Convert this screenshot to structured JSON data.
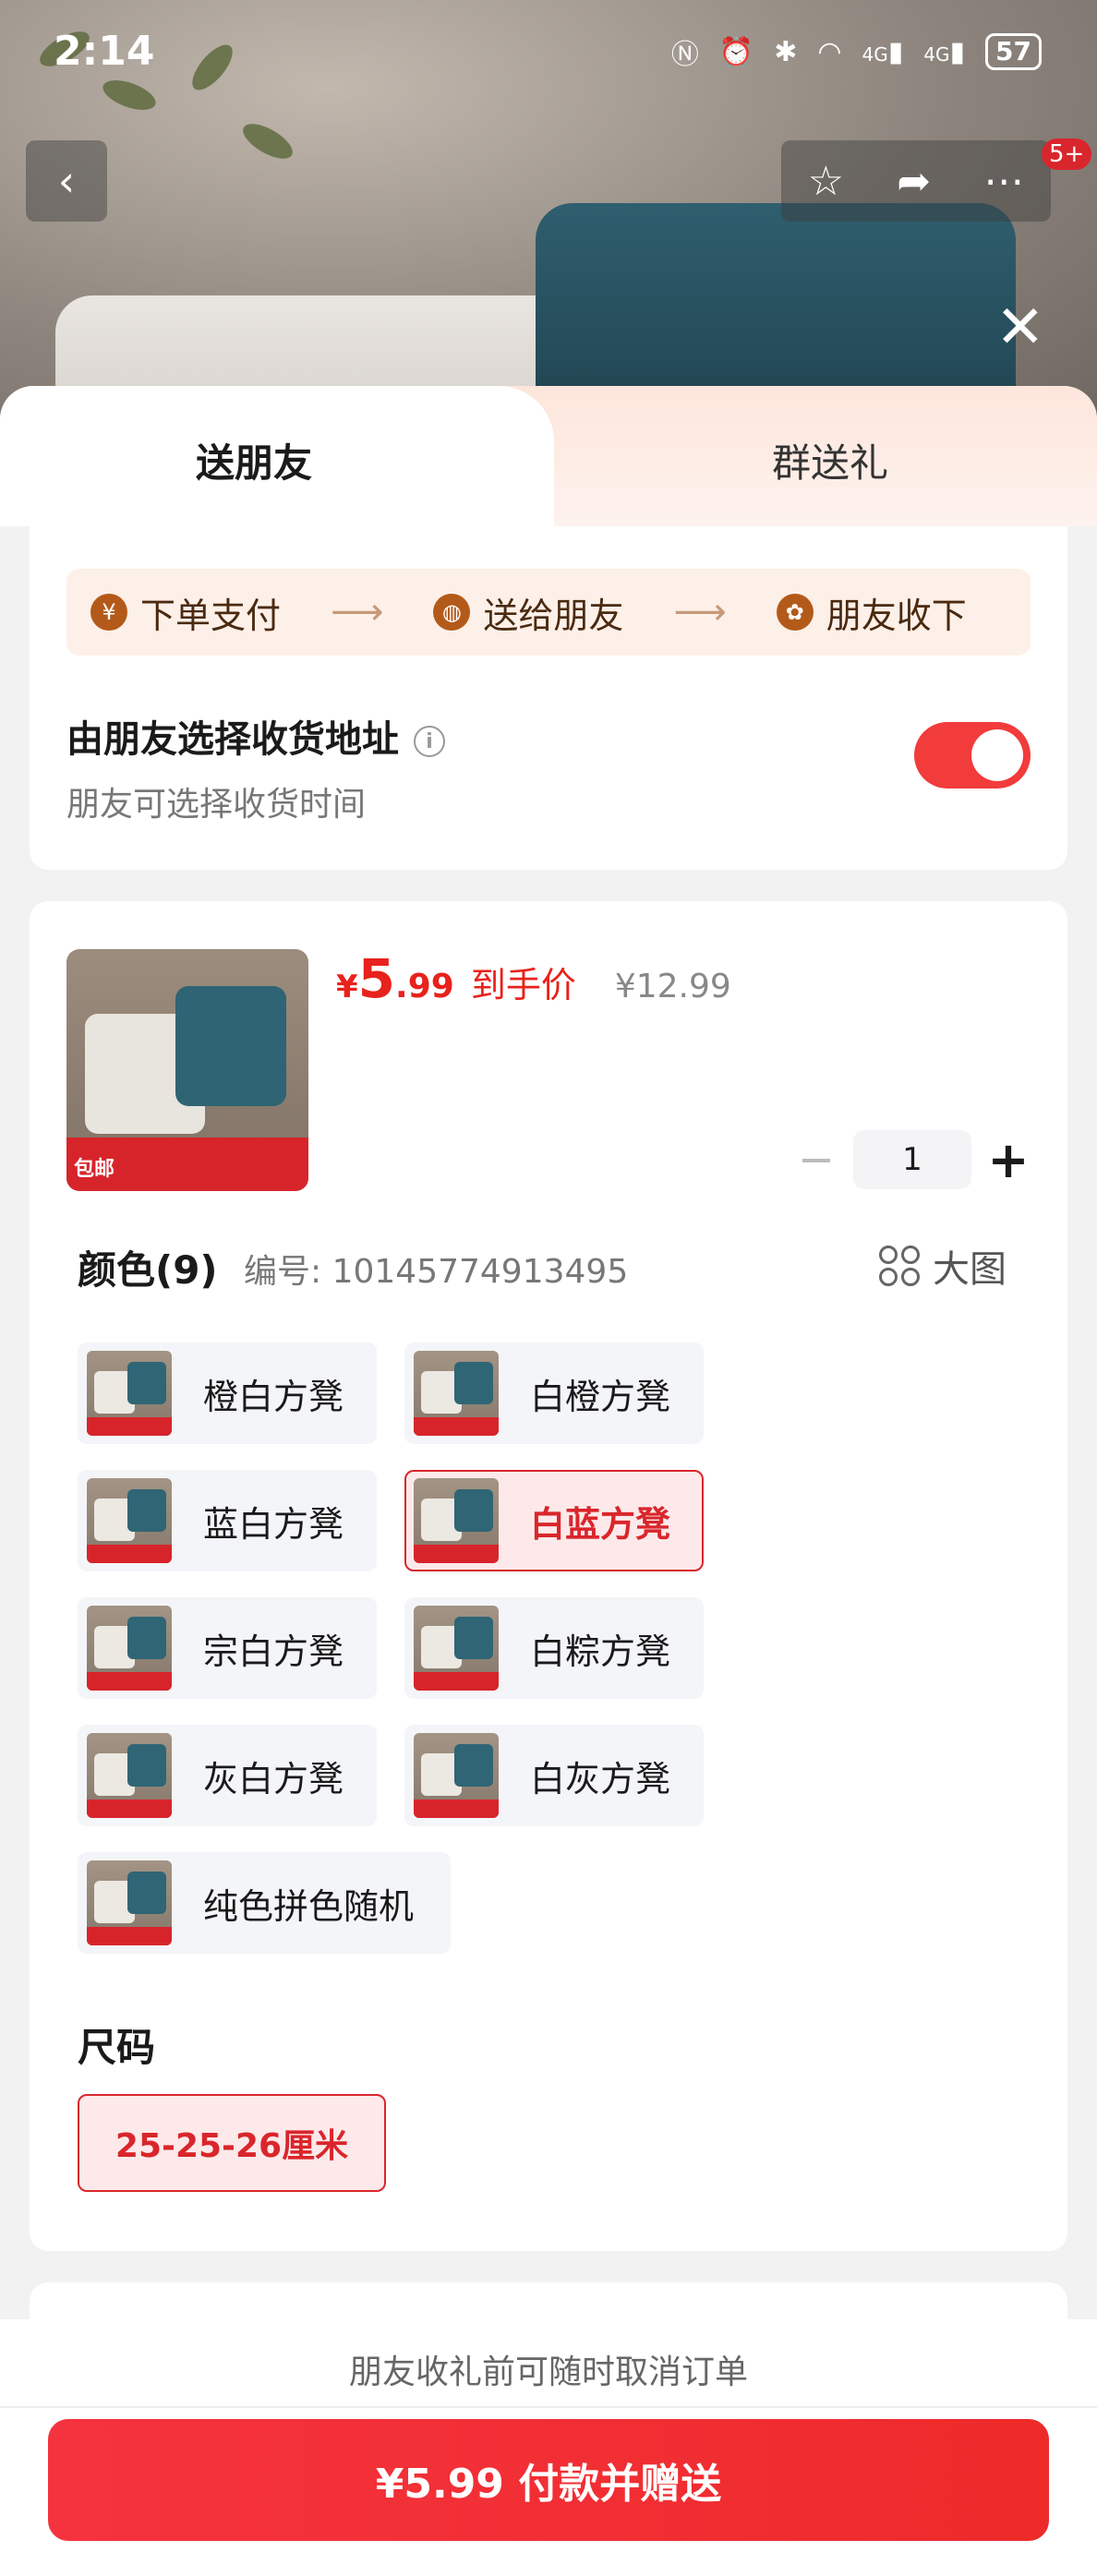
{
  "status": {
    "time": "2:14",
    "battery": "57",
    "net1": "4G",
    "net2": "4G"
  },
  "header": {
    "back_icon": "chevron-left-icon",
    "badge": "5+"
  },
  "tabs": [
    {
      "label": "送朋友"
    },
    {
      "label": "群送礼"
    }
  ],
  "steps": [
    {
      "label": "下单支付",
      "icon": "yen-icon"
    },
    {
      "label": "送给朋友",
      "icon": "wechat-icon"
    },
    {
      "label": "朋友收下",
      "icon": "gift-icon"
    }
  ],
  "address": {
    "title": "由朋友选择收货地址",
    "subtitle": "朋友可选择收货时间",
    "toggle_on": true
  },
  "product": {
    "thumb_badge": "包邮",
    "currency": "¥",
    "price_int": "5",
    "price_dec": ".99",
    "price_label": "到手价",
    "original_price": "¥12.99",
    "quantity": "1"
  },
  "color": {
    "heading": "颜色(9)",
    "code": "编号: 10145774913495",
    "big_image": "大图",
    "options": [
      {
        "label": "橙白方凳",
        "selected": false
      },
      {
        "label": "白橙方凳",
        "selected": false
      },
      {
        "label": "蓝白方凳",
        "selected": false
      },
      {
        "label": "白蓝方凳",
        "selected": true
      },
      {
        "label": "宗白方凳",
        "selected": false
      },
      {
        "label": "白粽方凳",
        "selected": false
      },
      {
        "label": "灰白方凳",
        "selected": false
      },
      {
        "label": "白灰方凳",
        "selected": false
      },
      {
        "label": "纯色拼色随机",
        "selected": false
      }
    ]
  },
  "size": {
    "heading": "尺码",
    "option": "25-25-26厘米"
  },
  "footer": {
    "note": "朋友收礼前可随时取消订单",
    "pay_button": "¥5.99 付款并赠送"
  },
  "colors": {
    "accent": "#e8221c",
    "toggle": "#f23b3b"
  }
}
